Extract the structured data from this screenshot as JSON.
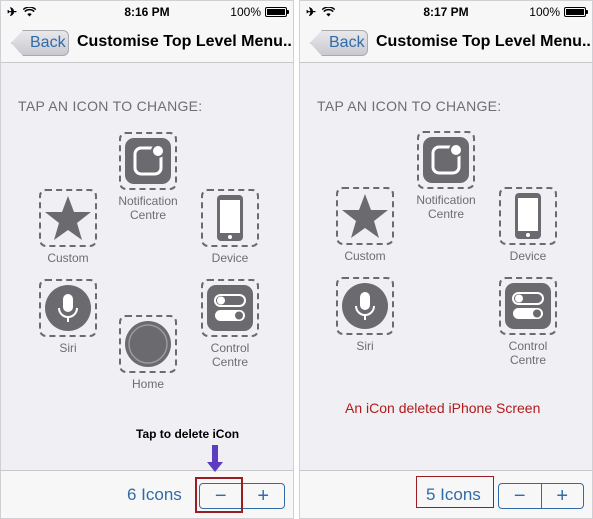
{
  "colors": {
    "accent": "#2f6ca8",
    "annotation_red": "#b21b1b",
    "highlight_border": "#9a1d22",
    "arrow": "#5b3cc2",
    "icon_gray": "#6b6b6f"
  },
  "left": {
    "status": {
      "time": "8:16 PM",
      "battery": "100%"
    },
    "nav": {
      "back": "Back",
      "title": "Customise Top Level Menu..."
    },
    "section_header": "TAP AN ICON TO CHANGE:",
    "icons": {
      "notification": {
        "line1": "Notification",
        "line2": "Centre",
        "icon": "notification-centre-icon"
      },
      "custom": {
        "label": "Custom",
        "icon": "star-icon"
      },
      "device": {
        "label": "Device",
        "icon": "iphone-icon"
      },
      "siri": {
        "label": "Siri",
        "icon": "microphone-icon"
      },
      "control": {
        "line1": "Control",
        "line2": "Centre",
        "icon": "toggle-icon"
      },
      "home": {
        "label": "Home",
        "icon": "home-button-icon"
      }
    },
    "bottom": {
      "count": "6 Icons",
      "minus": "−",
      "plus": "+"
    }
  },
  "right": {
    "status": {
      "time": "8:17 PM",
      "battery": "100%"
    },
    "nav": {
      "back": "Back",
      "title": "Customise Top Level Menu..."
    },
    "section_header": "TAP AN ICON TO CHANGE:",
    "icons": {
      "notification": {
        "line1": "Notification",
        "line2": "Centre",
        "icon": "notification-centre-icon"
      },
      "custom": {
        "label": "Custom",
        "icon": "star-icon"
      },
      "device": {
        "label": "Device",
        "icon": "iphone-icon"
      },
      "siri": {
        "label": "Siri",
        "icon": "microphone-icon"
      },
      "control": {
        "line1": "Control",
        "line2": "Centre",
        "icon": "toggle-icon"
      }
    },
    "bottom": {
      "count": "5 Icons",
      "minus": "−",
      "plus": "+"
    }
  },
  "annotations": {
    "tap_to_delete": "Tap to delete iCon",
    "deleted_screen": "An iCon deleted iPhone Screen"
  }
}
